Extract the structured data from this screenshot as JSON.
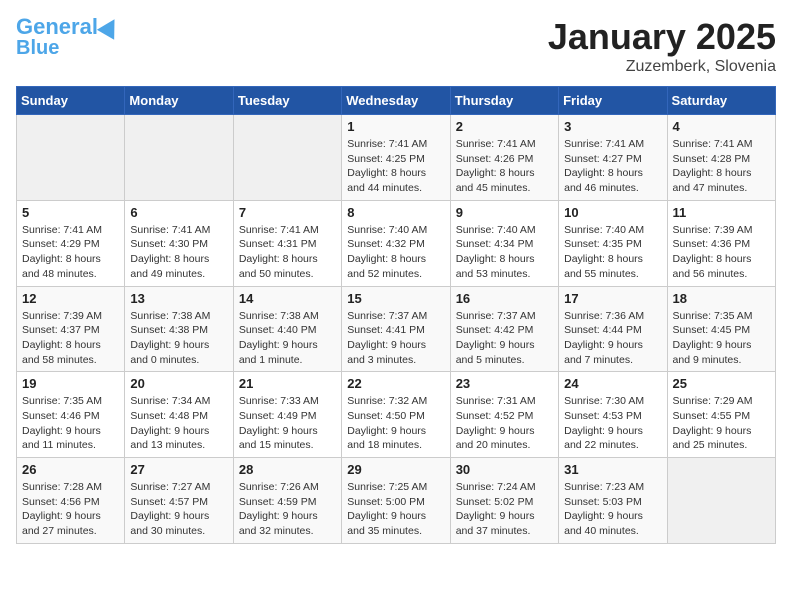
{
  "header": {
    "logo_line1": "General",
    "logo_line2": "Blue",
    "title": "January 2025",
    "subtitle": "Zuzemberk, Slovenia"
  },
  "weekdays": [
    "Sunday",
    "Monday",
    "Tuesday",
    "Wednesday",
    "Thursday",
    "Friday",
    "Saturday"
  ],
  "weeks": [
    [
      {
        "day": "",
        "info": ""
      },
      {
        "day": "",
        "info": ""
      },
      {
        "day": "",
        "info": ""
      },
      {
        "day": "1",
        "info": "Sunrise: 7:41 AM\nSunset: 4:25 PM\nDaylight: 8 hours\nand 44 minutes."
      },
      {
        "day": "2",
        "info": "Sunrise: 7:41 AM\nSunset: 4:26 PM\nDaylight: 8 hours\nand 45 minutes."
      },
      {
        "day": "3",
        "info": "Sunrise: 7:41 AM\nSunset: 4:27 PM\nDaylight: 8 hours\nand 46 minutes."
      },
      {
        "day": "4",
        "info": "Sunrise: 7:41 AM\nSunset: 4:28 PM\nDaylight: 8 hours\nand 47 minutes."
      }
    ],
    [
      {
        "day": "5",
        "info": "Sunrise: 7:41 AM\nSunset: 4:29 PM\nDaylight: 8 hours\nand 48 minutes."
      },
      {
        "day": "6",
        "info": "Sunrise: 7:41 AM\nSunset: 4:30 PM\nDaylight: 8 hours\nand 49 minutes."
      },
      {
        "day": "7",
        "info": "Sunrise: 7:41 AM\nSunset: 4:31 PM\nDaylight: 8 hours\nand 50 minutes."
      },
      {
        "day": "8",
        "info": "Sunrise: 7:40 AM\nSunset: 4:32 PM\nDaylight: 8 hours\nand 52 minutes."
      },
      {
        "day": "9",
        "info": "Sunrise: 7:40 AM\nSunset: 4:34 PM\nDaylight: 8 hours\nand 53 minutes."
      },
      {
        "day": "10",
        "info": "Sunrise: 7:40 AM\nSunset: 4:35 PM\nDaylight: 8 hours\nand 55 minutes."
      },
      {
        "day": "11",
        "info": "Sunrise: 7:39 AM\nSunset: 4:36 PM\nDaylight: 8 hours\nand 56 minutes."
      }
    ],
    [
      {
        "day": "12",
        "info": "Sunrise: 7:39 AM\nSunset: 4:37 PM\nDaylight: 8 hours\nand 58 minutes."
      },
      {
        "day": "13",
        "info": "Sunrise: 7:38 AM\nSunset: 4:38 PM\nDaylight: 9 hours\nand 0 minutes."
      },
      {
        "day": "14",
        "info": "Sunrise: 7:38 AM\nSunset: 4:40 PM\nDaylight: 9 hours\nand 1 minute."
      },
      {
        "day": "15",
        "info": "Sunrise: 7:37 AM\nSunset: 4:41 PM\nDaylight: 9 hours\nand 3 minutes."
      },
      {
        "day": "16",
        "info": "Sunrise: 7:37 AM\nSunset: 4:42 PM\nDaylight: 9 hours\nand 5 minutes."
      },
      {
        "day": "17",
        "info": "Sunrise: 7:36 AM\nSunset: 4:44 PM\nDaylight: 9 hours\nand 7 minutes."
      },
      {
        "day": "18",
        "info": "Sunrise: 7:35 AM\nSunset: 4:45 PM\nDaylight: 9 hours\nand 9 minutes."
      }
    ],
    [
      {
        "day": "19",
        "info": "Sunrise: 7:35 AM\nSunset: 4:46 PM\nDaylight: 9 hours\nand 11 minutes."
      },
      {
        "day": "20",
        "info": "Sunrise: 7:34 AM\nSunset: 4:48 PM\nDaylight: 9 hours\nand 13 minutes."
      },
      {
        "day": "21",
        "info": "Sunrise: 7:33 AM\nSunset: 4:49 PM\nDaylight: 9 hours\nand 15 minutes."
      },
      {
        "day": "22",
        "info": "Sunrise: 7:32 AM\nSunset: 4:50 PM\nDaylight: 9 hours\nand 18 minutes."
      },
      {
        "day": "23",
        "info": "Sunrise: 7:31 AM\nSunset: 4:52 PM\nDaylight: 9 hours\nand 20 minutes."
      },
      {
        "day": "24",
        "info": "Sunrise: 7:30 AM\nSunset: 4:53 PM\nDaylight: 9 hours\nand 22 minutes."
      },
      {
        "day": "25",
        "info": "Sunrise: 7:29 AM\nSunset: 4:55 PM\nDaylight: 9 hours\nand 25 minutes."
      }
    ],
    [
      {
        "day": "26",
        "info": "Sunrise: 7:28 AM\nSunset: 4:56 PM\nDaylight: 9 hours\nand 27 minutes."
      },
      {
        "day": "27",
        "info": "Sunrise: 7:27 AM\nSunset: 4:57 PM\nDaylight: 9 hours\nand 30 minutes."
      },
      {
        "day": "28",
        "info": "Sunrise: 7:26 AM\nSunset: 4:59 PM\nDaylight: 9 hours\nand 32 minutes."
      },
      {
        "day": "29",
        "info": "Sunrise: 7:25 AM\nSunset: 5:00 PM\nDaylight: 9 hours\nand 35 minutes."
      },
      {
        "day": "30",
        "info": "Sunrise: 7:24 AM\nSunset: 5:02 PM\nDaylight: 9 hours\nand 37 minutes."
      },
      {
        "day": "31",
        "info": "Sunrise: 7:23 AM\nSunset: 5:03 PM\nDaylight: 9 hours\nand 40 minutes."
      },
      {
        "day": "",
        "info": ""
      }
    ]
  ]
}
